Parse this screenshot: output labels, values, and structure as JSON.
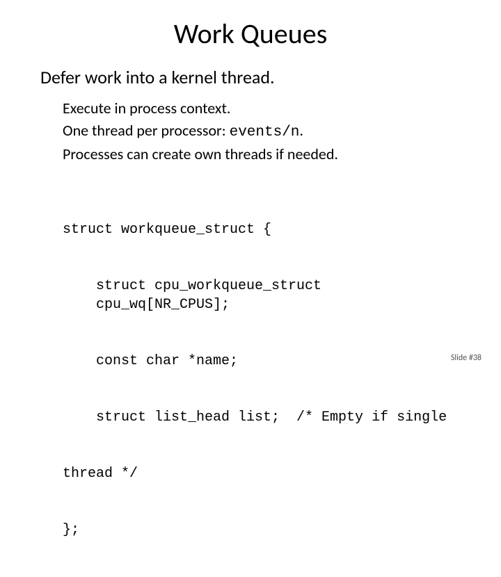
{
  "title": "Work Queues",
  "subhead": "Defer work into a kernel thread.",
  "bullets": {
    "b1": "Execute in process context.",
    "b2a": "One thread per processor: ",
    "b2b": "events/n",
    "b2c": ".",
    "b3": "Processes can create own threads if needed."
  },
  "code": {
    "l1": "struct workqueue_struct {",
    "l2": "struct cpu_workqueue_struct cpu_wq[NR_CPUS];",
    "l3": "const char *name;",
    "l4": "struct list_head list;  /* Empty if single",
    "l5": "thread */",
    "l6": "};"
  },
  "footer": "Slide #38"
}
